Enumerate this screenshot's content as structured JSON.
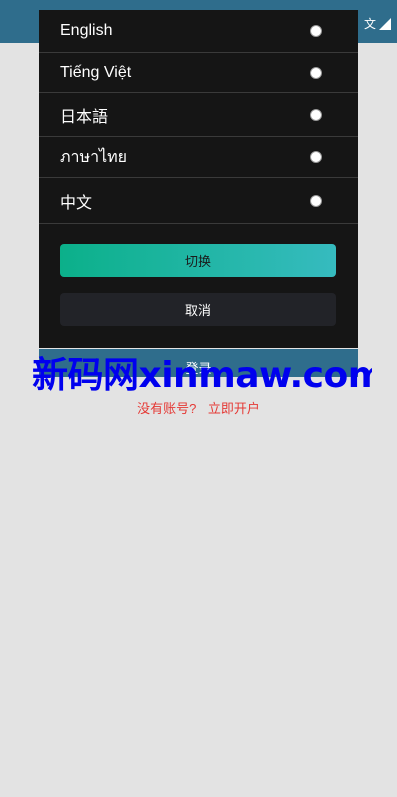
{
  "header": {
    "language_indicator": "文"
  },
  "login": {
    "button_label": "登录"
  },
  "signup": {
    "question": "没有账号?",
    "link": "立即开户"
  },
  "watermark": {
    "text": "新码网xinmaw.com"
  },
  "language_modal": {
    "options": [
      {
        "label": "English",
        "selected": false
      },
      {
        "label": "Tiếng Việt",
        "selected": false
      },
      {
        "label": "日本語",
        "selected": false
      },
      {
        "label": "ภาษาไทย",
        "selected": false
      },
      {
        "label": "中文",
        "selected": false
      }
    ],
    "confirm_label": "切换",
    "cancel_label": "取消"
  },
  "colors": {
    "header_bg": "#2f6d8c",
    "modal_bg": "#151515",
    "confirm_gradient_start": "#0bb08a",
    "confirm_gradient_end": "#36bbbf",
    "signup_text": "#e53935",
    "watermark": "#0000ee"
  }
}
